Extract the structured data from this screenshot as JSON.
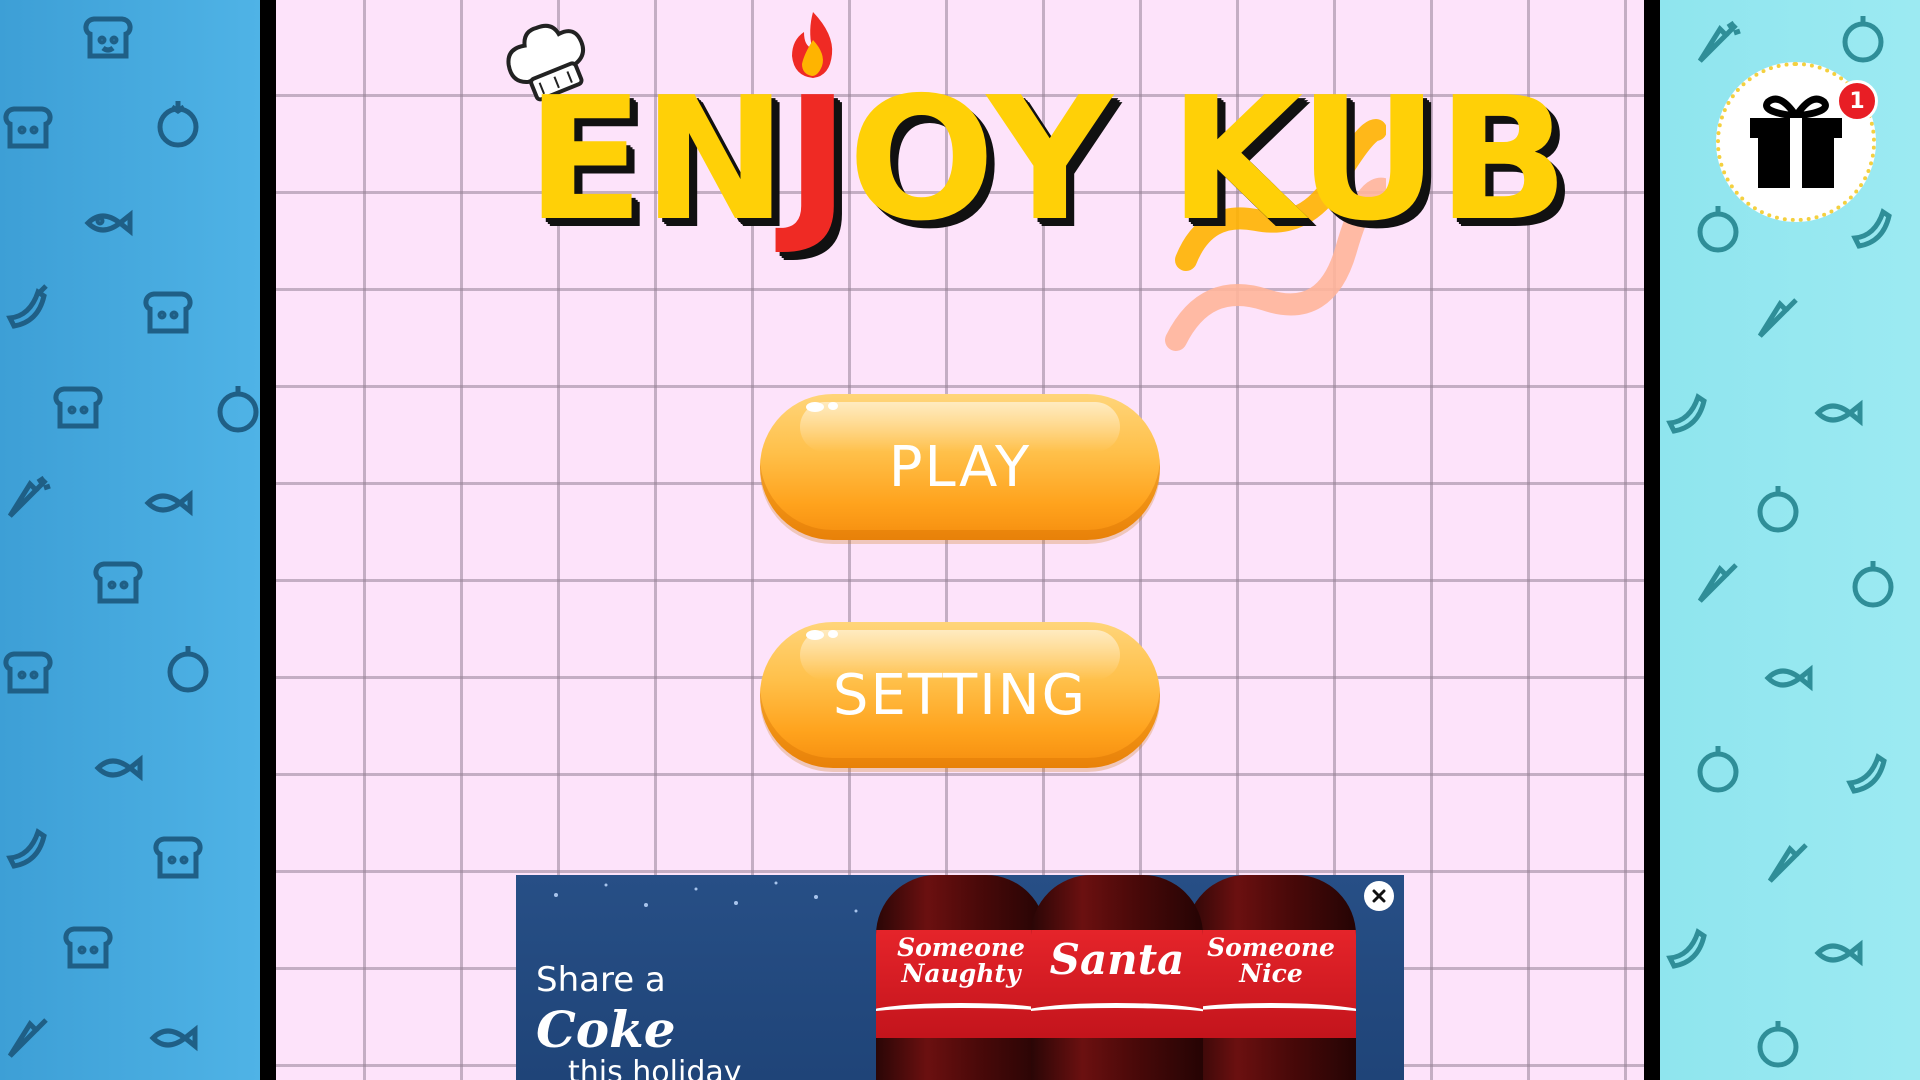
{
  "game": {
    "title_parts": [
      "EN",
      "J",
      "OY KUB"
    ],
    "menu": {
      "play_label": "PLAY",
      "setting_label": "SETTING"
    }
  },
  "ad": {
    "line1": "Share a",
    "brand": "Coke",
    "line2": "this holiday",
    "bottles": [
      {
        "name": "Someone\nNaughty"
      },
      {
        "name": "Santa"
      },
      {
        "name": "Someone\nNice"
      }
    ],
    "close_icon": "close-icon"
  },
  "gift": {
    "icon": "gift-icon",
    "badge_count": "1"
  },
  "colors": {
    "title_yellow": "#ffd007",
    "title_red": "#ef2a24",
    "button_orange": "#ffa31d",
    "left_panel": "#3d9fd6",
    "right_panel": "#9ceaf2",
    "paper": "#fde3fa",
    "badge_red": "#e81e25"
  }
}
